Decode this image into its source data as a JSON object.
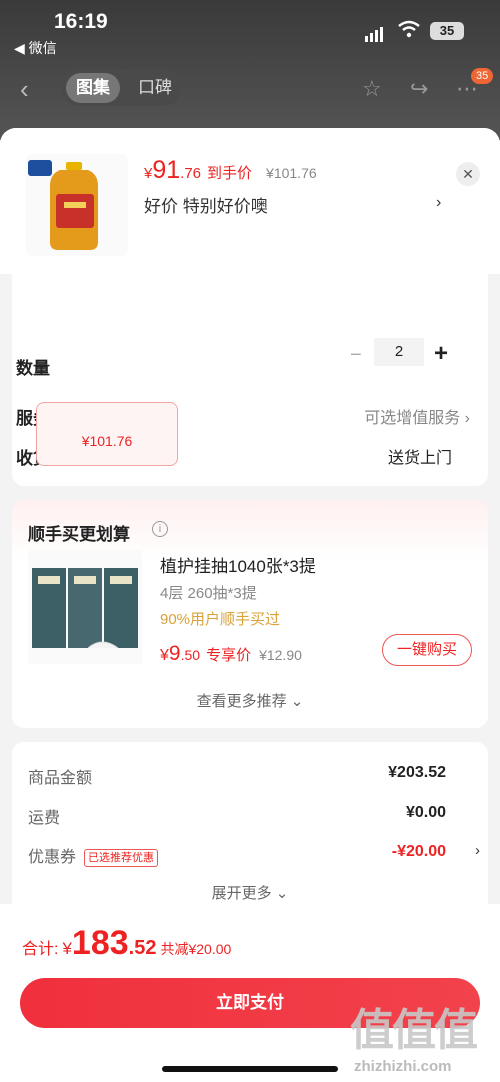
{
  "status": {
    "time": "16:19",
    "back_app": "◀ 微信",
    "battery": "35"
  },
  "nav": {
    "tab_active": "图集",
    "tab_second": "口碑",
    "cart_badge": "35"
  },
  "header": {
    "price_symbol": "¥",
    "price_int": "91",
    "price_dec": ".76",
    "price_label": "到手价",
    "orig_price": "¥101.76",
    "promo_text": "好价  特别好价噢",
    "promo_arrow": "›"
  },
  "spec": {
    "chip_price": "¥101.76"
  },
  "options": {
    "qty_label": "数量",
    "qty_value": "2",
    "service_label": "服务",
    "service_value": "可选增值服务",
    "delivery_label": "收货方式",
    "delivery_value": "送货上门"
  },
  "recommend": {
    "title": "顺手买更划算",
    "item_title": "植护挂抽1040张*3提",
    "item_sub": "4层 260抽*3提",
    "item_bought": "90%用户顺手买过",
    "price_symbol": "¥",
    "price_int": "9",
    "price_dec": ".50",
    "price_label": "专享价",
    "orig_price": "¥12.90",
    "buy_label": "一键购买",
    "more_label": "查看更多推荐 ⌄"
  },
  "summary": {
    "goods_label": "商品金额",
    "goods_value": "¥203.52",
    "shipping_label": "运费",
    "shipping_value": "¥0.00",
    "coupon_label": "优惠券",
    "coupon_tag": "已选推荐优惠",
    "coupon_value": "-¥20.00",
    "expand_label": "展开更多 ⌄"
  },
  "footer": {
    "total_label": "合计:",
    "total_symbol": "¥",
    "total_int": "183",
    "total_dec": ".52",
    "total_save": "共减¥20.00",
    "pay_label": "立即支付"
  },
  "watermark": {
    "brand": "值值值",
    "url": "zhizhizhi.com"
  }
}
